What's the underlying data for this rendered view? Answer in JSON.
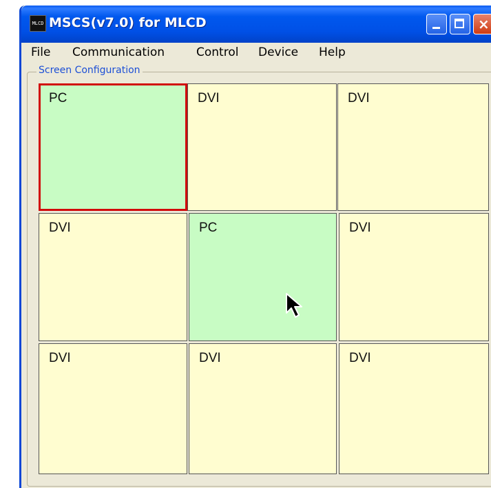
{
  "window": {
    "title": "MSCS(v7.0) for MLCD",
    "icon_name": "mlcd-app-icon",
    "icon_text": "MLCD"
  },
  "menu": [
    "File",
    "Communication",
    "Control",
    "Device",
    "Help"
  ],
  "group": {
    "label": "Screen Configuration"
  },
  "grid": {
    "rows": 3,
    "cols": 3,
    "cells": [
      {
        "label": "PC",
        "type": "pc",
        "selected": true
      },
      {
        "label": "DVI",
        "type": "dvi",
        "selected": false
      },
      {
        "label": "DVI",
        "type": "dvi",
        "selected": false
      },
      {
        "label": "DVI",
        "type": "dvi",
        "selected": false
      },
      {
        "label": "PC",
        "type": "pc",
        "selected": false
      },
      {
        "label": "DVI",
        "type": "dvi",
        "selected": false
      },
      {
        "label": "DVI",
        "type": "dvi",
        "selected": false
      },
      {
        "label": "DVI",
        "type": "dvi",
        "selected": false
      },
      {
        "label": "DVI",
        "type": "dvi",
        "selected": false
      }
    ]
  },
  "colors": {
    "pc_cell": "#c8fcc4",
    "dvi_cell": "#fffdd0",
    "selection_border": "#d10a0a",
    "titlebar": "#0058ee"
  },
  "cursor_icon": "mouse-pointer-icon"
}
